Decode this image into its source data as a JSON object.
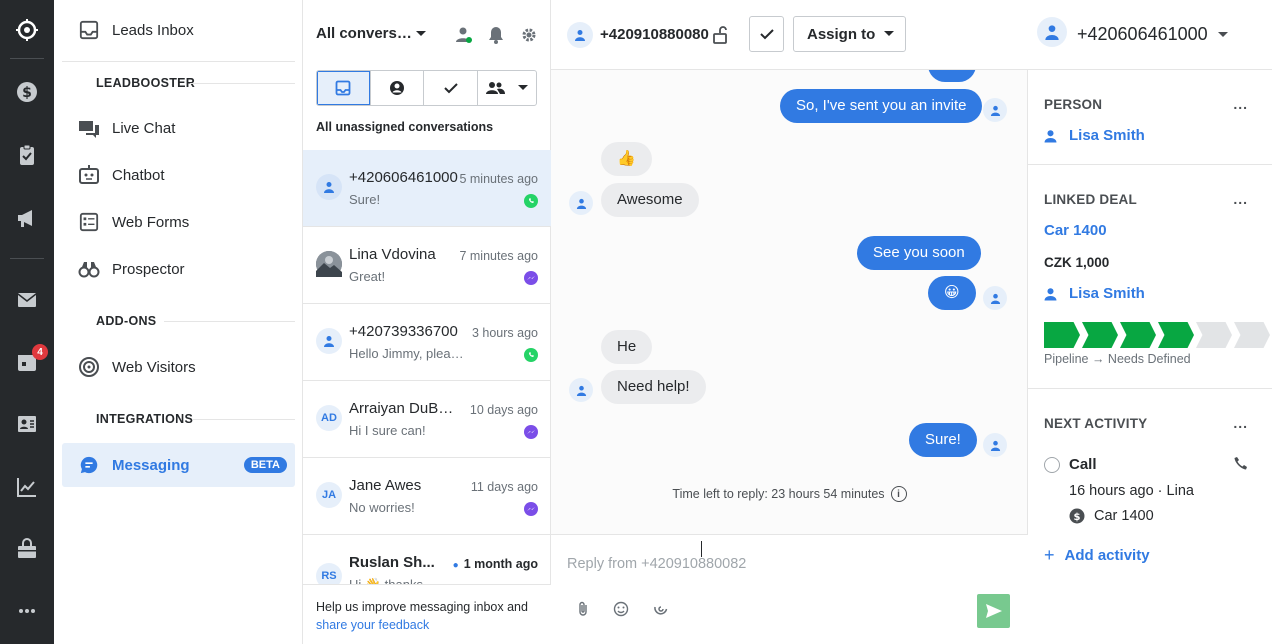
{
  "rail": {
    "badge": "4"
  },
  "sidebar": {
    "items": {
      "leads_inbox": "Leads Inbox",
      "live_chat": "Live Chat",
      "chatbot": "Chatbot",
      "web_forms": "Web Forms",
      "prospector": "Prospector",
      "web_visitors": "Web Visitors",
      "messaging": "Messaging"
    },
    "sections": {
      "leadbooster": "LEADBOOSTER",
      "addons": "ADD-ONS",
      "integrations": "INTEGRATIONS"
    },
    "beta_badge": "BETA"
  },
  "conversations": {
    "title": "All conversations",
    "subtitle": "All unassigned conversations",
    "items": [
      {
        "name": "+420606461000",
        "time": "5 minutes ago",
        "preview": "Sure!",
        "initials": "",
        "channel": "whatsapp"
      },
      {
        "name": "Lina Vdovina",
        "time": "7 minutes ago",
        "preview": "Great!",
        "initials": "",
        "channel": "messenger"
      },
      {
        "name": "+420739336700",
        "time": "3 hours ago",
        "preview": "Hello Jimmy, please let me know",
        "initials": "",
        "channel": "whatsapp"
      },
      {
        "name": "Arraiyan DuBose",
        "time": "10 days ago",
        "preview": "Hi I sure can!",
        "initials": "AD",
        "channel": "messenger"
      },
      {
        "name": "Jane Awes",
        "time": "11 days ago",
        "preview": "No worries!",
        "initials": "JA",
        "channel": "messenger"
      },
      {
        "name": "Ruslan Sh...",
        "time": "1 month ago",
        "preview": "Hi 👋 thanks",
        "initials": "RS",
        "channel": "messenger"
      }
    ],
    "feedback": {
      "text": "Help us improve messaging inbox and",
      "link": "share your feedback"
    }
  },
  "chat": {
    "phone": "+420910880080",
    "assign_label": "Assign to",
    "messages": {
      "m1": "So, I've sent you an invite",
      "m2": "👍",
      "m3": "Awesome",
      "m4": "See you soon",
      "m5": "😀",
      "m6": "He",
      "m7": "Need help!",
      "m8": "Sure!"
    },
    "time_left": "Time left to reply: 23 hours 54 minutes",
    "reply_placeholder": "Reply from +420910880082"
  },
  "detail": {
    "phone": "+420606461000",
    "person": {
      "title": "PERSON",
      "name": "Lisa Smith"
    },
    "deal": {
      "title": "LINKED DEAL",
      "name": "Car 1400",
      "value": "CZK 1,000",
      "person": "Lisa Smith",
      "pipeline": "Pipeline → Needs Defined",
      "stages_done": 4,
      "stages_total": 6
    },
    "activity": {
      "title": "NEXT ACTIVITY",
      "type": "Call",
      "when": "16 hours ago · Lina",
      "deal": "Car 1400",
      "add": "Add activity"
    },
    "more": "..."
  },
  "colors": {
    "accent": "#317ae2",
    "rail": "#26292c",
    "success": "#08a742",
    "whatsapp": "#25d366",
    "messenger": "#7b4ee8"
  }
}
